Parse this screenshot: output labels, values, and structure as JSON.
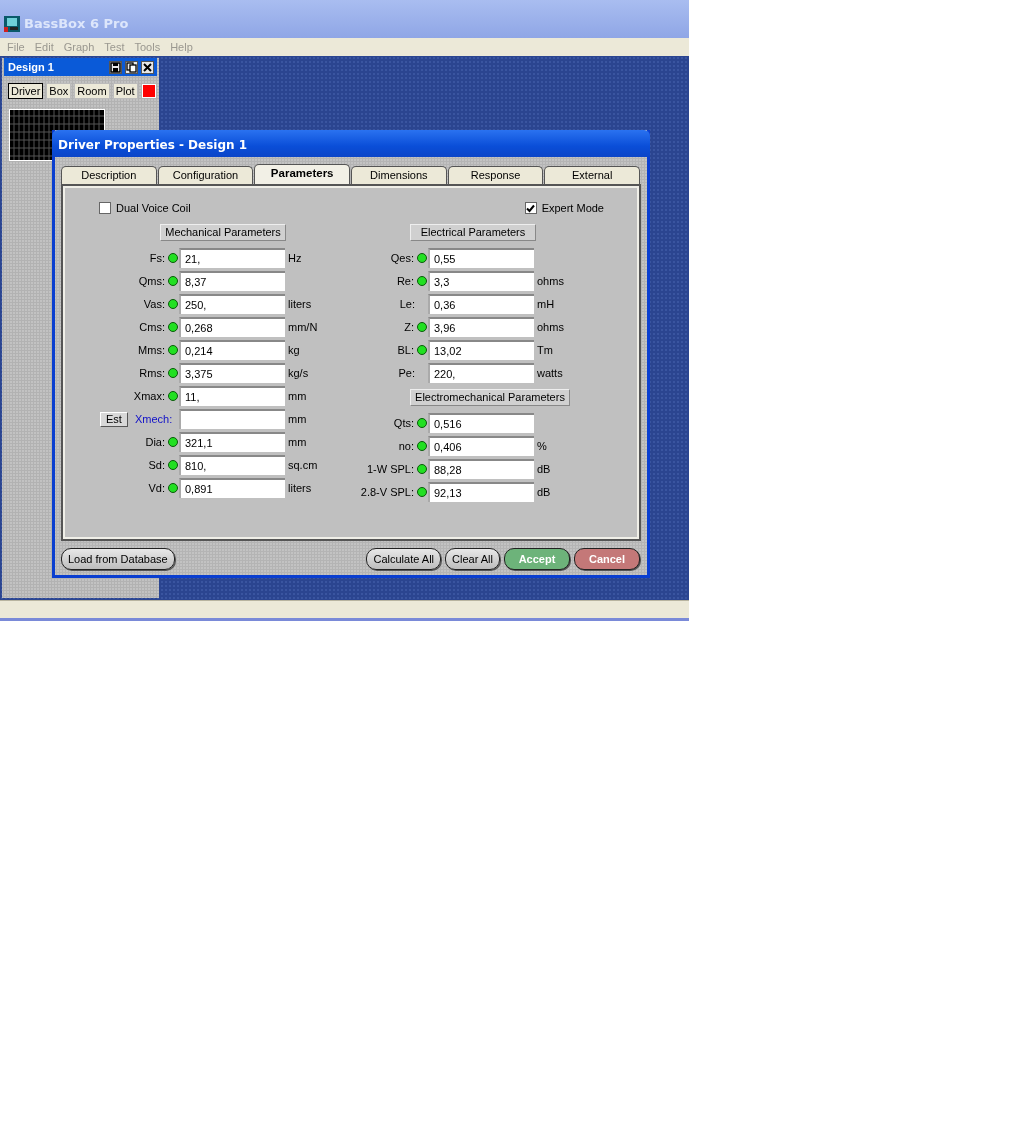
{
  "window": {
    "title": "BassBox 6 Pro"
  },
  "menu": [
    "File",
    "Edit",
    "Graph",
    "Test",
    "Tools",
    "Help"
  ],
  "design_window": {
    "title": "Design 1",
    "tabs": [
      {
        "label": "Driver",
        "selected": true
      },
      {
        "label": "Box",
        "selected": false
      },
      {
        "label": "Room",
        "selected": false
      },
      {
        "label": "Plot",
        "selected": false
      }
    ],
    "swatch": {
      "color": "#ff0000"
    }
  },
  "dialog": {
    "title": "Driver Properties - Design 1",
    "tabs": [
      {
        "label": "Description",
        "selected": false
      },
      {
        "label": "Configuration",
        "selected": false
      },
      {
        "label": "Parameters",
        "selected": true
      },
      {
        "label": "Dimensions",
        "selected": false
      },
      {
        "label": "Response",
        "selected": false
      },
      {
        "label": "External",
        "selected": false
      }
    ],
    "options": [
      {
        "label": "Dual Voice Coil",
        "checked": false
      },
      {
        "label": "Expert Mode",
        "checked": true
      }
    ],
    "groups": [
      {
        "title": "Mechanical Parameters",
        "rows": [
          {
            "kind": "param",
            "label": "Fs:",
            "indicator": true,
            "value": "21,",
            "unit": "Hz"
          },
          {
            "kind": "param",
            "label": "Qms:",
            "indicator": true,
            "value": "8,37"
          },
          {
            "kind": "param",
            "label": "Vas:",
            "indicator": true,
            "value": "250,",
            "unit": "liters"
          },
          {
            "kind": "param",
            "label": "Cms:",
            "indicator": true,
            "value": "0,268",
            "unit": "mm/N"
          },
          {
            "kind": "param",
            "label": "Mms:",
            "indicator": true,
            "value": "0,214",
            "unit": "kg"
          },
          {
            "kind": "param",
            "label": "Rms:",
            "indicator": true,
            "value": "3,375",
            "unit": "kg/s"
          },
          {
            "kind": "param",
            "label": "Xmax:",
            "indicator": true,
            "value": "11,",
            "unit": "mm"
          },
          {
            "kind": "estimate",
            "button": "Est",
            "label": "Xmech:",
            "unit": "mm"
          },
          {
            "kind": "param",
            "label": "Dia:",
            "indicator": true,
            "value": "321,1",
            "unit": "mm"
          },
          {
            "kind": "param",
            "label": "Sd:",
            "indicator": true,
            "value": "810,",
            "unit": "sq.cm"
          },
          {
            "kind": "param",
            "label": "Vd:",
            "indicator": true,
            "value": "0,891",
            "unit": "liters"
          }
        ]
      },
      {
        "title": "Electrical Parameters",
        "rows": [
          {
            "kind": "param",
            "label": "Qes:",
            "indicator": true,
            "value": "0,55"
          },
          {
            "kind": "param",
            "label": "Re:",
            "indicator": true,
            "value": "3,3",
            "unit": "ohms"
          },
          {
            "kind": "param",
            "label": "Le:",
            "indicator": false,
            "value": "0,36",
            "unit": "mH"
          },
          {
            "kind": "param",
            "label": "Z:",
            "indicator": true,
            "value": "3,96",
            "unit": "ohms"
          },
          {
            "kind": "param",
            "label": "BL:",
            "indicator": true,
            "value": "13,02",
            "unit": "Tm"
          },
          {
            "kind": "param",
            "label": "Pe:",
            "indicator": false,
            "value": "220,",
            "unit": "watts"
          }
        ]
      },
      {
        "title": "Electromechanical Parameters",
        "rows": [
          {
            "kind": "param",
            "label": "Qts:",
            "indicator": true,
            "value": "0,516"
          },
          {
            "kind": "param",
            "label": "no:",
            "indicator": true,
            "value": "0,406",
            "unit": "%"
          },
          {
            "kind": "param",
            "label": "1-W SPL:",
            "indicator": true,
            "value": "88,28",
            "unit": "dB"
          },
          {
            "kind": "param",
            "label": "2.8-V SPL:",
            "indicator": true,
            "value": "92,13",
            "unit": "dB"
          }
        ]
      }
    ],
    "buttons": [
      {
        "label": "Load from Database",
        "kind": "plain"
      },
      {
        "label": "Calculate All",
        "kind": "plain"
      },
      {
        "label": "Clear All",
        "kind": "plain"
      },
      {
        "label": "Accept",
        "kind": "accept"
      },
      {
        "label": "Cancel",
        "kind": "cancel"
      }
    ]
  }
}
